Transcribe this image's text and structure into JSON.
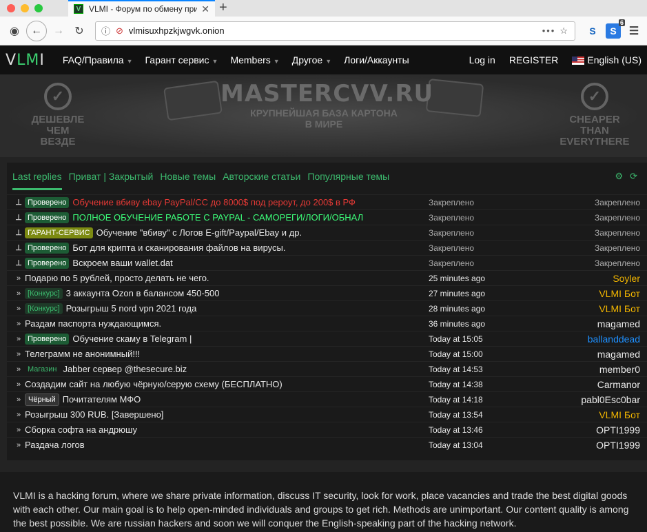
{
  "browser": {
    "tab_title": "VLMI - Форум по обмену прив",
    "favicon_text": "V",
    "url": "vlmisuxhpzkjwgvk.onion",
    "ext_badge": "6"
  },
  "header": {
    "logo_left": "V",
    "logo_mid": "LM",
    "logo_right": "I",
    "menu": [
      {
        "label": "FAQ/Правила"
      },
      {
        "label": "Гарант сервис"
      },
      {
        "label": "Members"
      },
      {
        "label": "Другое"
      },
      {
        "label": "Логи/Аккаунты"
      }
    ],
    "login": "Log in",
    "register": "REGISTER",
    "language": "English (US)"
  },
  "banner": {
    "title": "MASTERCVV.RU",
    "subtitle1": "КРУПНЕЙШАЯ БАЗА КАРТОНА",
    "subtitle2": "В МИРЕ",
    "left_text": [
      "ДЕШЕВЛЕ",
      "ЧЕМ",
      "ВЕЗДЕ"
    ],
    "right_text": [
      "CHEAPER",
      "THAN",
      "EVERYTHERE"
    ]
  },
  "tabs": [
    "Last replies",
    "Приват | Закрытый",
    "Новые темы",
    "Авторские статьи",
    "Популярные темы"
  ],
  "threads": [
    {
      "icon": "pin",
      "badge": "Проверено",
      "badge_type": "ver",
      "title": "Обучение вбиву ebay PayPal/CC до 8000$ под рероут, до 200$ в РФ",
      "title_style": "red",
      "time": "Закреплено",
      "user": "Закреплено",
      "user_style": "gray"
    },
    {
      "icon": "pin",
      "badge": "Проверено",
      "badge_type": "ver",
      "title": "ПОЛНОЕ ОБУЧЕНИЕ РАБОТЕ С PAYPAL - САМОРЕГИ/ЛОГИ/ОБНАЛ",
      "title_style": "green",
      "time": "Закреплено",
      "user": "Закреплено",
      "user_style": "gray"
    },
    {
      "icon": "pin",
      "badge": "ГАРАНТ-СЕРВИС",
      "badge_type": "gar",
      "title": "Обучение \"вбиву\" с Логов E-gift/Paypal/Ebay и др.",
      "title_style": "",
      "time": "Закреплено",
      "user": "Закреплено",
      "user_style": "gray"
    },
    {
      "icon": "pin",
      "badge": "Проверено",
      "badge_type": "ver",
      "title": "Бот для крипта и сканирования файлов на вирусы.",
      "title_style": "",
      "time": "Закреплено",
      "user": "Закреплено",
      "user_style": "gray"
    },
    {
      "icon": "pin",
      "badge": "Проверено",
      "badge_type": "ver",
      "title": "Вскроем ваши wallet.dat",
      "title_style": "",
      "time": "Закреплено",
      "user": "Закреплено",
      "user_style": "gray"
    },
    {
      "icon": "arrow",
      "badge": "",
      "badge_type": "",
      "title": "Подарю по 5 рублей, просто делать не чего.",
      "title_style": "",
      "time": "25 minutes ago",
      "user": "Soyler",
      "user_style": "gold"
    },
    {
      "icon": "arrow",
      "badge": "[Конкурс]",
      "badge_type": "kon",
      "title": "3 аккаунта Ozon в балансом 450-500",
      "title_style": "",
      "time": "27 minutes ago",
      "user": "VLMI Бот",
      "user_style": "gold"
    },
    {
      "icon": "arrow",
      "badge": "[Конкурс]",
      "badge_type": "kon",
      "title": "Розыгрыш 5 nord vpn 2021 года",
      "title_style": "",
      "time": "28 minutes ago",
      "user": "VLMI Бот",
      "user_style": "gold"
    },
    {
      "icon": "arrow",
      "badge": "",
      "badge_type": "",
      "title": "Раздам паспорта нуждающимся.",
      "title_style": "",
      "time": "36 minutes ago",
      "user": "magamed",
      "user_style": "white"
    },
    {
      "icon": "arrow",
      "badge": "Проверено",
      "badge_type": "ver",
      "title": "Обучение скаму в Telegram |",
      "title_style": "",
      "time": "Today at 15:05",
      "user": "ballanddead",
      "user_style": "blue"
    },
    {
      "icon": "arrow",
      "badge": "",
      "badge_type": "",
      "title": "Телеграмм не анонимный!!!",
      "title_style": "",
      "time": "Today at 15:00",
      "user": "magamed",
      "user_style": "white"
    },
    {
      "icon": "arrow",
      "badge": "Магазин",
      "badge_type": "mag",
      "title": "Jabber сервер @thesecure.biz",
      "title_style": "",
      "time": "Today at 14:53",
      "user": "member0",
      "user_style": "white"
    },
    {
      "icon": "arrow",
      "badge": "",
      "badge_type": "",
      "title": "Создадим сайт на любую чёрную/серую схему (БЕСПЛАТНО)",
      "title_style": "",
      "time": "Today at 14:38",
      "user": "Carmanor",
      "user_style": "white"
    },
    {
      "icon": "arrow",
      "badge": "Чёрный",
      "badge_type": "chr",
      "title": "Почитателям МФО",
      "title_style": "",
      "time": "Today at 14:18",
      "user": "pabl0Esc0bar",
      "user_style": "white"
    },
    {
      "icon": "arrow",
      "badge": "",
      "badge_type": "",
      "title": "Розыгрыш 300 RUB. [Завершено]",
      "title_style": "",
      "time": "Today at 13:54",
      "user": "VLMI Бот",
      "user_style": "gold"
    },
    {
      "icon": "arrow",
      "badge": "",
      "badge_type": "",
      "title": "Сборка софта на андрюшу",
      "title_style": "",
      "time": "Today at 13:46",
      "user": "OPTI1999",
      "user_style": "white"
    },
    {
      "icon": "arrow",
      "badge": "",
      "badge_type": "",
      "title": "Раздача логов",
      "title_style": "",
      "time": "Today at 13:04",
      "user": "OPTI1999",
      "user_style": "white"
    }
  ],
  "footer": {
    "text": "VLMI is a hacking forum, where we share private information, discuss IT security, look for work, place vacancies and trade the best digital goods with each other. Our main goal is to help open-minded individuals and groups to get rich. Methods are unimportant. Our content quality is among the best possible. We are russian hackers and soon we will conquer the English-speaking part of the hacking network."
  }
}
